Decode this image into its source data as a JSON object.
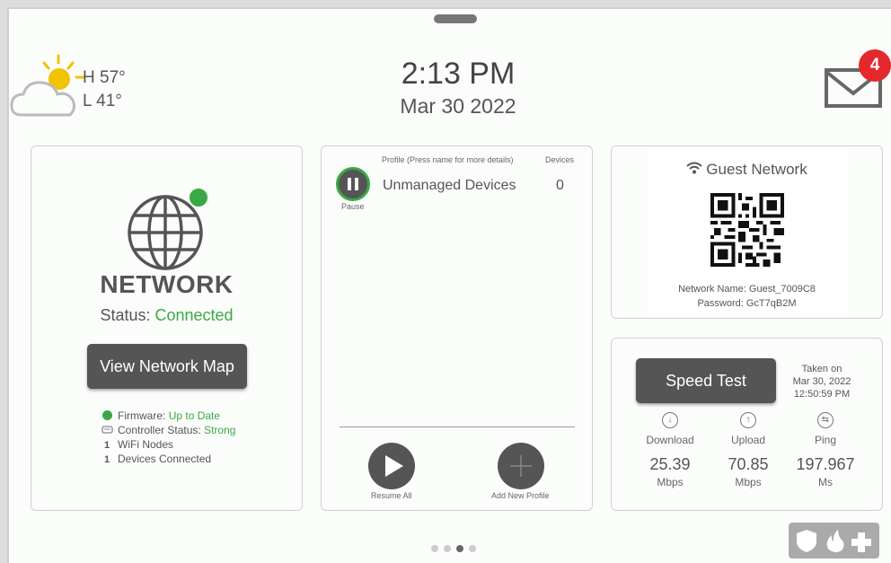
{
  "weather": {
    "high": "H 57°",
    "low": "L 41°",
    "icon": "partly-cloudy-icon"
  },
  "clock": {
    "time": "2:13 PM",
    "date": "Mar 30 2022"
  },
  "notifications": {
    "count": "4",
    "icon": "mail-icon"
  },
  "network": {
    "title": "NETWORK",
    "status_label": "Status:",
    "status_value": "Connected",
    "map_button": "View Network Map",
    "firmware_label": "Firmware:",
    "firmware_value": "Up to Date",
    "controller_label": "Controller Status:",
    "controller_value": "Strong",
    "wifi_nodes_count": "1",
    "wifi_nodes_label": "WiFi Nodes",
    "devices_count": "1",
    "devices_label": "Devices Connected"
  },
  "profiles": {
    "header_profile": "Profile (Press name for more details)",
    "header_devices": "Devices",
    "items": [
      {
        "name": "Unmanaged Devices",
        "devices": "0",
        "action": "Pause"
      }
    ],
    "resume_all": "Resume All",
    "add_new": "Add New Profile"
  },
  "guest": {
    "title": "Guest Network",
    "network_name": "Network Name: Guest_7009C8",
    "password": "Password: GcT7qB2M"
  },
  "speedtest": {
    "button": "Speed Test",
    "taken_on": "Taken on",
    "taken_date": "Mar 30, 2022",
    "taken_time": "12:50:59 PM",
    "metrics": [
      {
        "label": "Download",
        "value": "25.39",
        "unit": "Mbps"
      },
      {
        "label": "Upload",
        "value": "70.85",
        "unit": "Mbps"
      },
      {
        "label": "Ping",
        "value": "197.967",
        "unit": "Ms"
      }
    ]
  },
  "pager": {
    "pages": 4,
    "active": 3
  },
  "colors": {
    "accent_green": "#3aa845",
    "badge_red": "#e4282b",
    "button_dark": "#555555"
  }
}
